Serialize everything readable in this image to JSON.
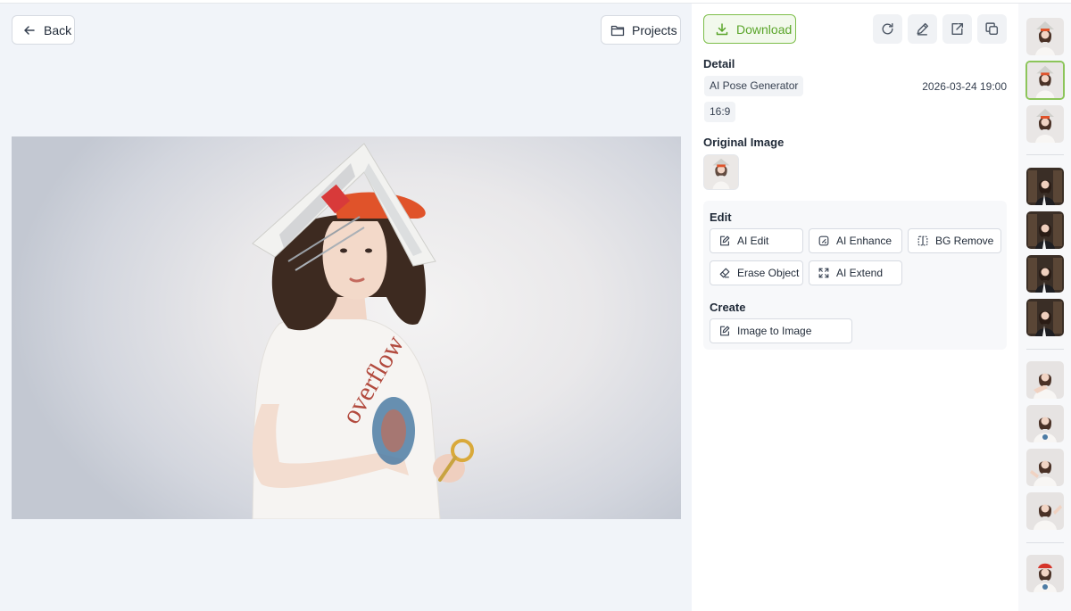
{
  "nav": {
    "back_label": "Back",
    "projects_label": "Projects"
  },
  "toolbar": {
    "download_label": "Download",
    "icons": [
      "refresh-icon",
      "pencil-icon",
      "share-icon",
      "copy-icon"
    ]
  },
  "detail": {
    "title": "Detail",
    "generator": "AI Pose Generator",
    "date": "2026-03-24 19:00",
    "ratio": "16:9"
  },
  "original": {
    "title": "Original Image"
  },
  "edit": {
    "title": "Edit",
    "actions": [
      "AI Edit",
      "AI Enhance",
      "BG Remove",
      "Erase Object",
      "AI Extend"
    ]
  },
  "create": {
    "title": "Create",
    "actions": [
      "Image to Image"
    ]
  },
  "colors": {
    "accent": "#5aa52a",
    "accent_border": "#7dbe4a",
    "cap": "#e0532a"
  }
}
